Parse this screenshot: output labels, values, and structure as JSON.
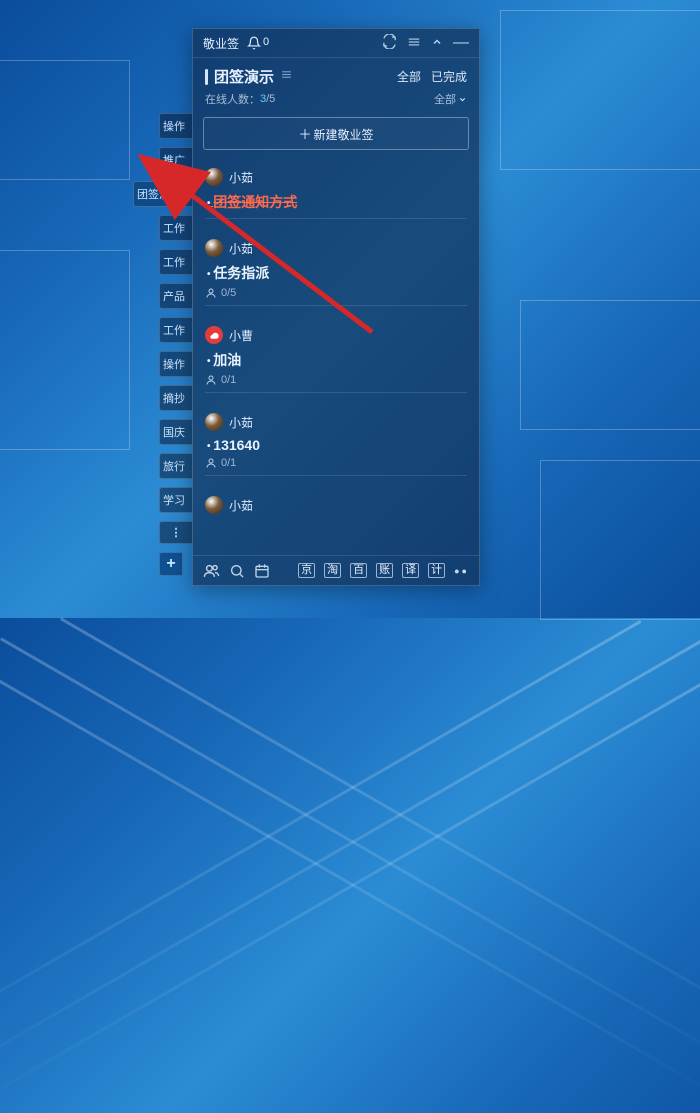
{
  "window": {
    "app_title": "敬业签",
    "bell_count": "0"
  },
  "panel": {
    "title": "团签演示",
    "filter_all": "全部",
    "filter_done": "已完成",
    "online_label": "在线人数：",
    "online_current": "3",
    "online_total": "/5",
    "scope_label": "全部",
    "new_button": "新建敬业签"
  },
  "sidebar": [
    "操作",
    "推广",
    "团签演示",
    "工作",
    "工作",
    "产品",
    "工作",
    "操作",
    "摘抄",
    "国庆",
    "旅行",
    "学习"
  ],
  "sidebar_more": "⋮",
  "sidebar_add": "+",
  "items": [
    {
      "user": "小茹",
      "title": "团签通知方式",
      "strike": true
    },
    {
      "user": "小茹",
      "title": "任务指派",
      "progress": "0/5"
    },
    {
      "user": "小曹",
      "title": "加油",
      "progress": "0/1",
      "avatar_red": true
    },
    {
      "user": "小茹",
      "title": "131640",
      "progress": "0/1"
    },
    {
      "user": "小茹"
    }
  ],
  "bottom_shortcuts": [
    "京",
    "淘",
    "百",
    "账",
    "译",
    "计"
  ]
}
